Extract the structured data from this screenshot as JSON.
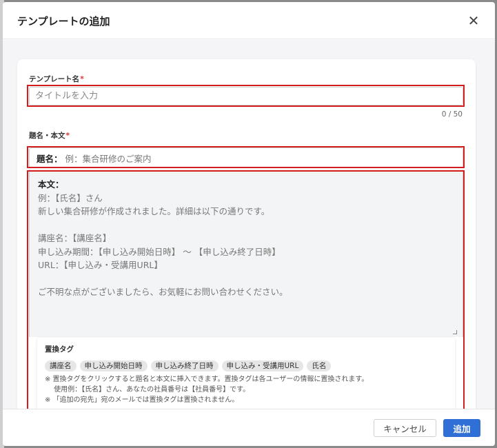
{
  "modal": {
    "title": "テンプレートの追加",
    "close_icon": "close-icon"
  },
  "form": {
    "title_field": {
      "label": "テンプレート名",
      "required_mark": "*",
      "placeholder": "タイトルを入力",
      "value": "",
      "counter": "0 / 50"
    },
    "content_field": {
      "label": "題名・本文",
      "required_mark": "*",
      "subject_label": "題名：",
      "subject_placeholder": "例：集合研修のご案内",
      "body_label": "本文：",
      "body_placeholder_lines": [
        "例：【氏名】さん",
        "新しい集合研修が作成されました。詳細は以下の通りです。",
        "",
        "講座名：【講座名】",
        "申し込み期間：【申し込み開始日時】 ～ 【申し込み終了日時】",
        "URL：【申し込み・受講用URL】",
        "",
        "ご不明な点がございましたら、お気軽にお問い合わせください。"
      ]
    },
    "tags": {
      "title": "置換タグ",
      "items": [
        "講座名",
        "申し込み開始日時",
        "申し込み終了日時",
        "申し込み・受講用URL",
        "氏名"
      ],
      "notes": [
        "※ 置換タグをクリックすると題名と本文に挿入できます。置換タグは各ユーザーの情報に置換されます。",
        "　 使用例：【氏名】さん、あなたの社員番号は【社員番号】です。",
        "※ 「追加の宛先」宛のメールでは置換タグは置換されません。"
      ]
    }
  },
  "footer": {
    "cancel_label": "キャンセル",
    "submit_label": "追加"
  },
  "colors": {
    "accent": "#2f6fd6",
    "highlight": "#d31c1c",
    "required": "#e03131"
  }
}
